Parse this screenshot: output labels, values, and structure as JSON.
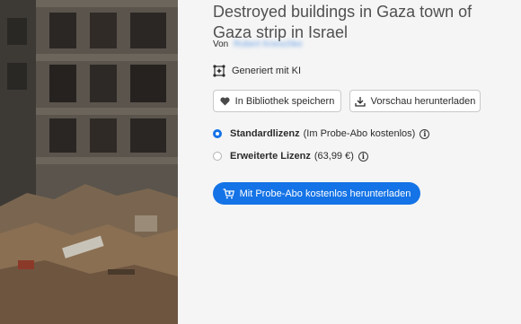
{
  "asset": {
    "title": "Destroyed buildings in Gaza town of Gaza strip in Israel",
    "author_prefix": "Von",
    "author_name": "Robert Kneschke",
    "ai_badge": "Generiert mit KI"
  },
  "actions": {
    "save_label": "In Bibliothek speichern",
    "preview_label": "Vorschau herunterladen",
    "download_label": "Mit Probe-Abo kostenlos herunterladen"
  },
  "licenses": [
    {
      "name": "Standardlizenz",
      "note": "(Im Probe-Abo kostenlos)",
      "selected": true
    },
    {
      "name": "Erweiterte Lizenz",
      "note": "(63,99 €)",
      "selected": false
    }
  ],
  "colors": {
    "accent": "#1473e6",
    "background": "#f5f5f5",
    "title_text": "#505050"
  },
  "icons": {
    "ai": "ai-sparkle-icon",
    "save": "heart-icon",
    "preview": "download-icon",
    "download": "cart-icon",
    "info": "info-icon"
  }
}
